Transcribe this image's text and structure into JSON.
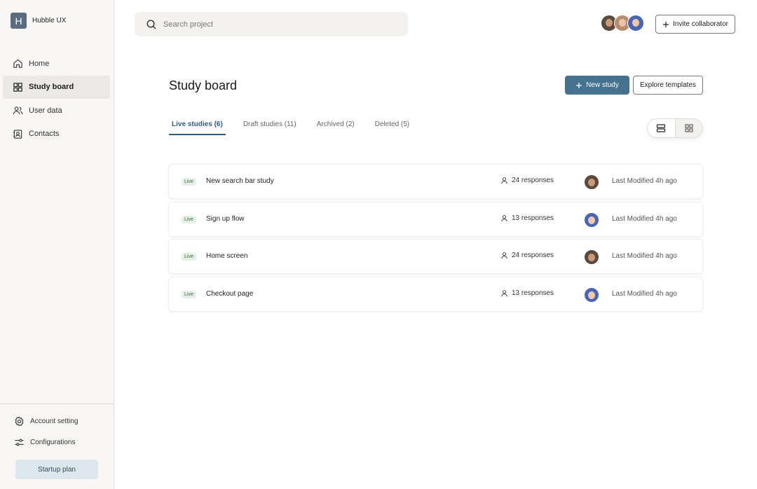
{
  "workspace": {
    "logo_letter": "H",
    "name": "Hubble UX"
  },
  "sidebar": {
    "items": [
      {
        "label": "Home",
        "icon": "home-icon"
      },
      {
        "label": "Study board",
        "icon": "grid-icon",
        "active": true
      },
      {
        "label": "User data",
        "icon": "users-icon"
      },
      {
        "label": "Contacts",
        "icon": "contacts-icon"
      }
    ],
    "bottom_items": [
      {
        "label": "Account setting",
        "icon": "gear-icon"
      },
      {
        "label": "Configurations",
        "icon": "sliders-icon"
      }
    ],
    "plan_label": "Startup plan"
  },
  "search": {
    "placeholder": "Search project"
  },
  "header": {
    "invite_label": "Invite collaborator",
    "title": "Study board",
    "new_study_label": "New study",
    "templates_label": "Explore templates"
  },
  "tabs": [
    {
      "label": "Live studies (6)",
      "active": true
    },
    {
      "label": "Draft studies (11)"
    },
    {
      "label": "Archived (2)"
    },
    {
      "label": "Deleted (5)"
    }
  ],
  "studies": [
    {
      "badge": "Live",
      "name": "New search bar study",
      "responses": "24 responses",
      "avatar": "avatar-a",
      "modified": "Last Modified 4h ago"
    },
    {
      "badge": "Live",
      "name": "Sign up flow",
      "responses": "13 responses",
      "avatar": "avatar-c",
      "modified": "Last Modified 4h ago"
    },
    {
      "badge": "Live",
      "name": "Home screen",
      "responses": "24 responses",
      "avatar": "avatar-a",
      "modified": "Last Modified 4h ago"
    },
    {
      "badge": "Live",
      "name": "Checkout page",
      "responses": "13 responses",
      "avatar": "avatar-c",
      "modified": "Last Modified 4h ago"
    }
  ],
  "colors": {
    "primary": "#46718f",
    "active_tab": "#2f5e80",
    "live_badge_bg": "#e5f1e6",
    "live_badge_text": "#2e6b3a",
    "sidebar_bg": "#f8f7f5"
  }
}
